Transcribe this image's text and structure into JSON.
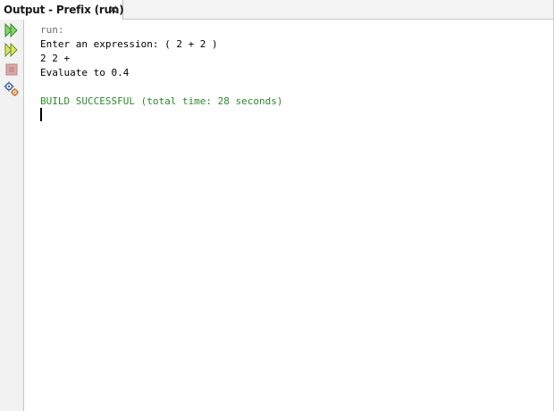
{
  "tab": {
    "title": "Output - Prefix (run)",
    "close_icon": "close-icon"
  },
  "toolbar": {
    "items": [
      {
        "icon": "rerun-icon",
        "color": "#3aa63a"
      },
      {
        "icon": "rerun-with-options-icon",
        "color": "#3aa63a"
      },
      {
        "icon": "stop-icon",
        "color": "#c46a6a"
      },
      {
        "icon": "settings-icon",
        "color": "#5a7fb8"
      }
    ]
  },
  "output": {
    "lines": [
      "run:",
      "Enter an expression: ( 2 + 2 )",
      "2 2 +",
      "Evaluate to 0.4",
      "BUILD SUCCESSFUL (total time: 28 seconds)"
    ]
  },
  "colors": {
    "run_text": "#6e6e6e",
    "success_text": "#2a8a2a",
    "stdout_text": "#000000"
  }
}
